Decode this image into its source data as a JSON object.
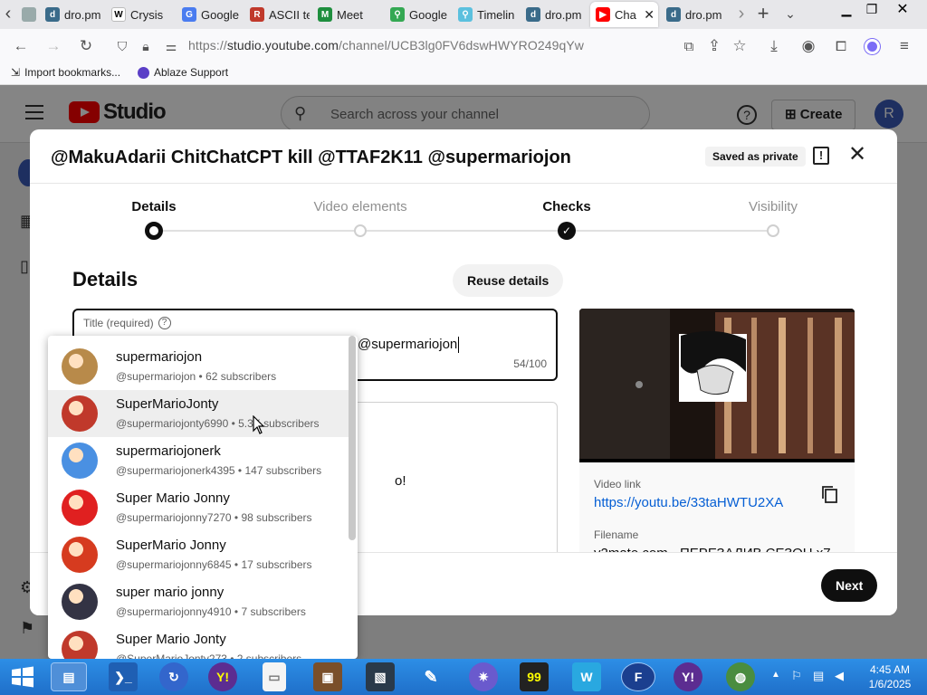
{
  "browser": {
    "tabs": [
      {
        "label": "dro.pm",
        "color": "#3a6b8a",
        "glyph": "d"
      },
      {
        "label": "Crysis",
        "color": "#ffffff",
        "glyph": "W"
      },
      {
        "label": "Google",
        "color": "#4a7cf0",
        "glyph": "G"
      },
      {
        "label": "ASCII te",
        "color": "#c0392b",
        "glyph": "R"
      },
      {
        "label": "Meet",
        "color": "#1e8e3e",
        "glyph": "M"
      },
      {
        "label": "Google",
        "color": "#34a853",
        "glyph": "⚲"
      },
      {
        "label": "Timelin",
        "color": "#5bc0de",
        "glyph": "⚲"
      },
      {
        "label": "dro.pm",
        "color": "#3a6b8a",
        "glyph": "d"
      },
      {
        "label": "Cha",
        "color": "#ff0000",
        "glyph": "▶"
      },
      {
        "label": "dro.pm",
        "color": "#3a6b8a",
        "glyph": "d"
      }
    ],
    "url_host": "studio.youtube.com",
    "url_prefix": "https://",
    "url_path": "/channel/UCB3lg0FV6dswHWYRO249qYw",
    "bookmarks": [
      "Import bookmarks...",
      "Ablaze Support"
    ]
  },
  "studio": {
    "logo": "Studio",
    "search_placeholder": "Search across your channel",
    "create_label": "Create",
    "avatar_letter": "R"
  },
  "dialog": {
    "title": "@MakuAdarii ChitChatCPT kill @TTAF2K11 @supermariojon",
    "saved_chip": "Saved as private",
    "steps": [
      {
        "label": "Details",
        "state": "current"
      },
      {
        "label": "Video elements",
        "state": "pending"
      },
      {
        "label": "Checks",
        "state": "done"
      },
      {
        "label": "Visibility",
        "state": "pending"
      }
    ],
    "section_heading": "Details",
    "reuse_button": "Reuse details",
    "title_field": {
      "label": "Title (required)",
      "visible_value": "@supermariojon",
      "counter": "54/100"
    },
    "description_fragment": "o!",
    "video_link_label": "Video link",
    "video_link": "https://youtu.be/33taHWTU2XA",
    "filename_label": "Filename",
    "filename": "y2mate.com - ПЕРЕЗАЛИВ СЕЗОН x7",
    "next_button": "Next"
  },
  "mentions": [
    {
      "name": "supermariojon",
      "sub": "@supermariojon • 62 subscribers",
      "color": "#b88a4a"
    },
    {
      "name": "SuperMarioJonty",
      "sub": "@supermariojonty6990 • 5.3K subscribers",
      "color": "#c0392b"
    },
    {
      "name": "supermariojonerk",
      "sub": "@supermariojonerk4395 • 147 subscribers",
      "color": "#4a90e2"
    },
    {
      "name": "Super Mario Jonny",
      "sub": "@supermariojonny7270 • 98 subscribers",
      "color": "#e02020"
    },
    {
      "name": "SuperMario Jonny",
      "sub": "@supermariojonny6845 • 17 subscribers",
      "color": "#d63b1f"
    },
    {
      "name": "super mario jonny",
      "sub": "@supermariojonny4910 • 7 subscribers",
      "color": "#333344"
    },
    {
      "name": "Super Mario Jonty",
      "sub": "@SuperMarioJonty273 • 2 subscribers",
      "color": "#c0392b"
    }
  ],
  "taskbar": {
    "time": "4:45 AM",
    "date": "1/6/2025"
  }
}
